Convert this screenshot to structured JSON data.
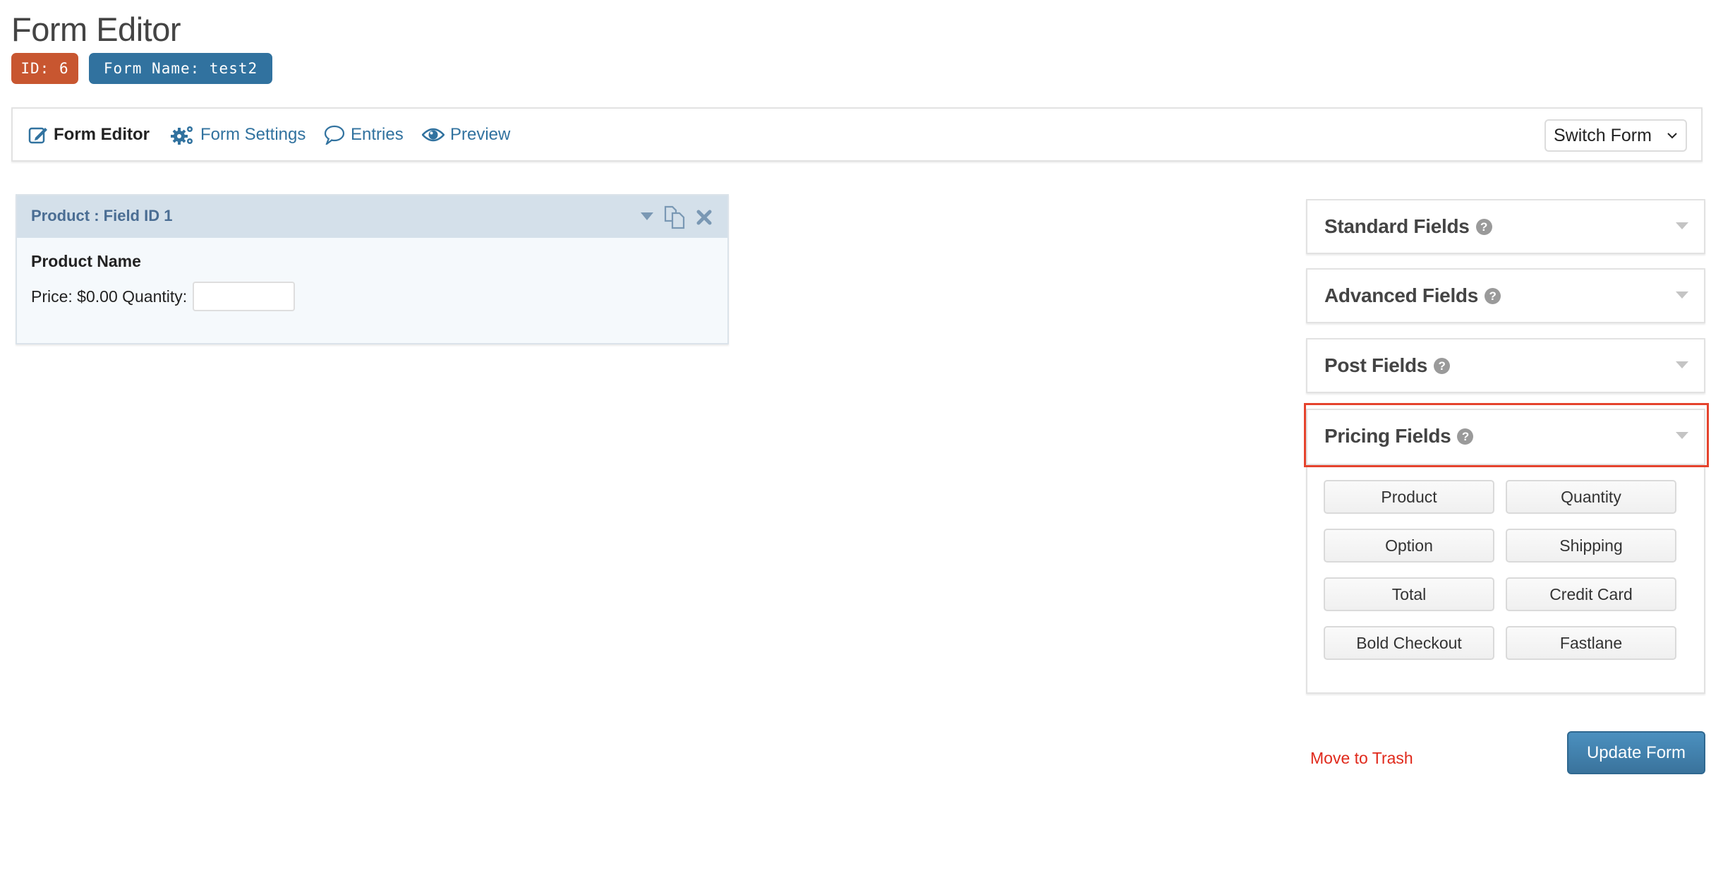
{
  "page": {
    "title": "Form Editor",
    "badges": {
      "id": "ID: 6",
      "form_name": "Form Name: test2"
    }
  },
  "nav": {
    "items": [
      {
        "label": "Form Editor",
        "icon": "edit-icon",
        "active": true
      },
      {
        "label": "Form Settings",
        "icon": "gears-icon",
        "active": false
      },
      {
        "label": "Entries",
        "icon": "comment-icon",
        "active": false
      },
      {
        "label": "Preview",
        "icon": "eye-icon",
        "active": false
      }
    ],
    "switch_form": "Switch Form"
  },
  "field": {
    "header": "Product : Field ID 1",
    "label": "Product Name",
    "price_text": "Price: $0.00 Quantity:",
    "quantity_value": ""
  },
  "panels": {
    "standard": "Standard Fields",
    "advanced": "Advanced Fields",
    "post": "Post Fields",
    "pricing": "Pricing Fields",
    "help_glyph": "?"
  },
  "pricing_buttons": [
    "Product",
    "Quantity",
    "Option",
    "Shipping",
    "Total",
    "Credit Card",
    "Bold Checkout",
    "Fastlane"
  ],
  "actions": {
    "move_to_trash": "Move to Trash",
    "update_form": "Update Form"
  },
  "colors": {
    "id_badge": "#c85630",
    "name_badge": "#31729f",
    "link": "#31729f",
    "highlight": "#e5432d",
    "trash": "#e0291b"
  }
}
